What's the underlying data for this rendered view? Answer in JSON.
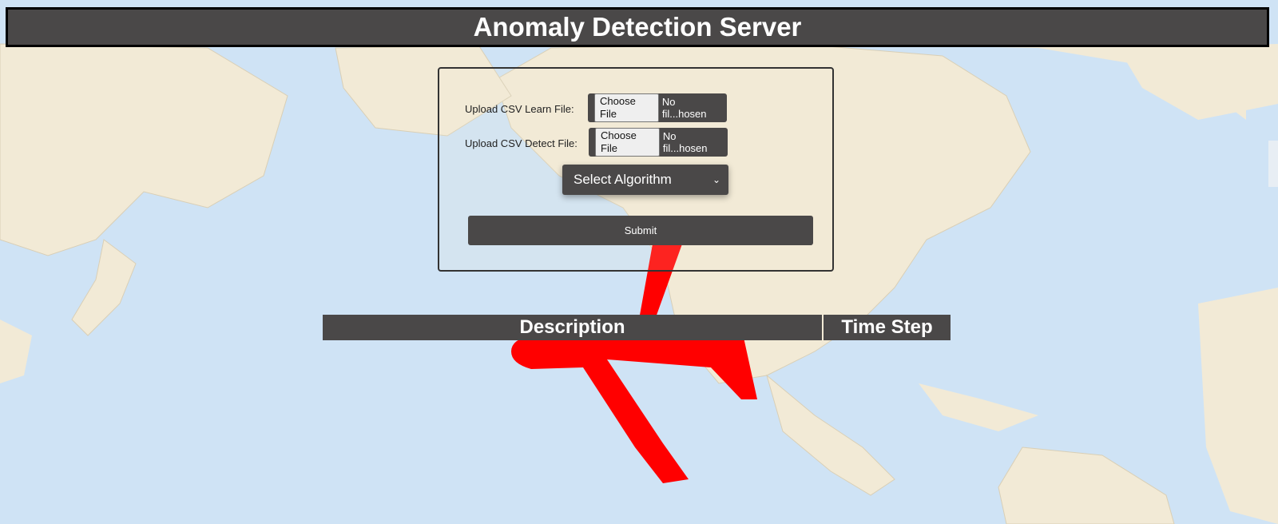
{
  "header": {
    "title": "Anomaly Detection Server"
  },
  "form": {
    "learn_label": "Upload CSV Learn File:",
    "detect_label": "Upload CSV Detect File:",
    "choose_file_label": "Choose File",
    "learn_status": "No fil...hosen",
    "detect_status": "No fil...hosen",
    "algorithm_select": {
      "selected": "Select Algorithm"
    },
    "submit_label": "Submit"
  },
  "results_table": {
    "columns": [
      "Description",
      "Time Step"
    ]
  },
  "background": {
    "icon": "airplane-icon",
    "map": "world-map"
  },
  "colors": {
    "header_bg": "#4a4848",
    "airplane": "#ff0000",
    "ocean": "#cfe3f5",
    "land": "#f2ead6"
  }
}
